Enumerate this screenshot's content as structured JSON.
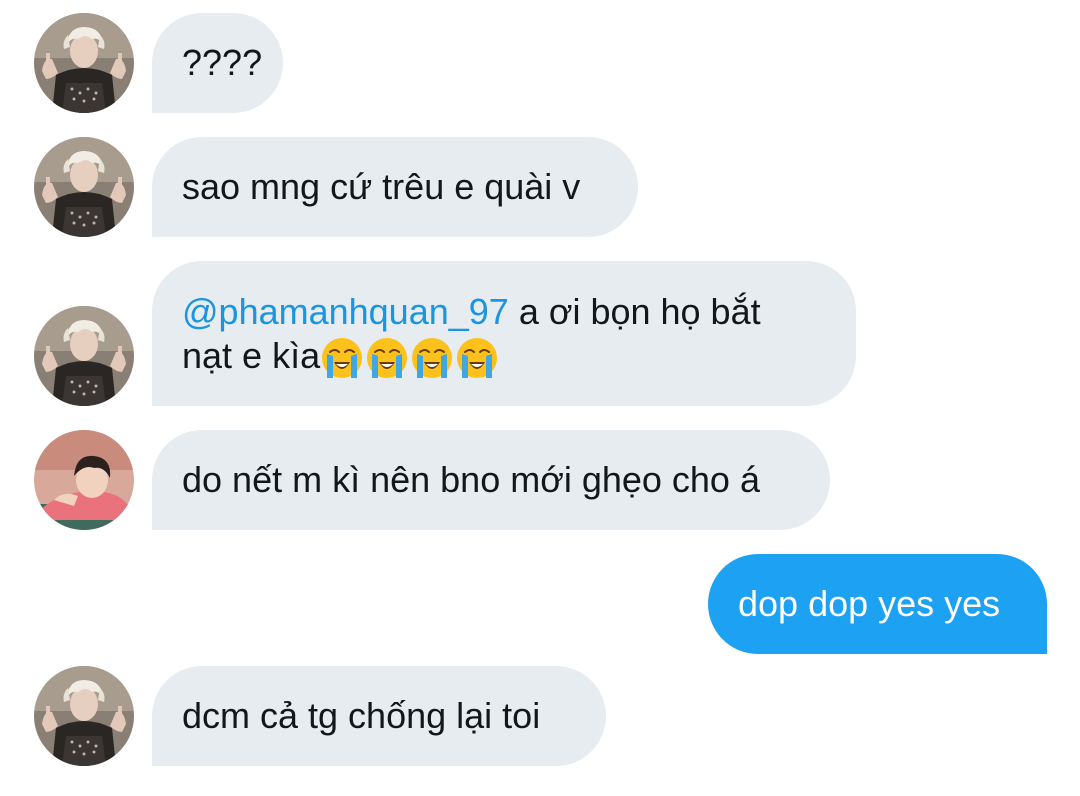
{
  "conversation": {
    "messages": [
      {
        "sender": "other",
        "avatar": "user-a",
        "text": "????"
      },
      {
        "sender": "other",
        "avatar": "user-a",
        "text": "sao mng cứ trêu e quài v"
      },
      {
        "sender": "other",
        "avatar": "user-a",
        "mention": "@phamanhquan_97",
        "text_line1": " a ơi bọn họ bắt",
        "text_line2": "nạt e kìa",
        "emojis": [
          "loudly-crying-face-icon",
          "loudly-crying-face-icon",
          "loudly-crying-face-icon",
          "loudly-crying-face-icon"
        ]
      },
      {
        "sender": "other",
        "avatar": "user-b",
        "text": "do nết m kì nên bno mới ghẹo cho á"
      },
      {
        "sender": "me",
        "text": "dop dop yes yes"
      },
      {
        "sender": "other",
        "avatar": "user-a",
        "text": "dcm cả tg chống lại toi"
      }
    ]
  },
  "colors": {
    "incoming_bubble": "#e6ecf0",
    "outgoing_bubble": "#1da1f2",
    "mention": "#1b95e0",
    "text": "#14171a"
  }
}
